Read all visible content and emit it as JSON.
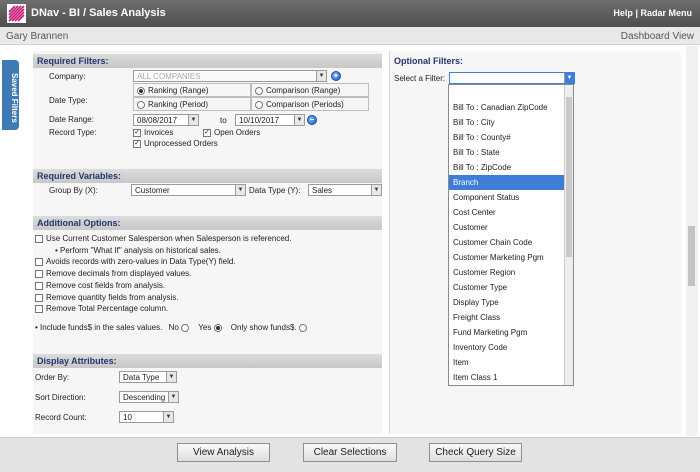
{
  "header": {
    "title": "DNav - BI / Sales Analysis",
    "help": "Help",
    "separator": "|",
    "radar_menu": "Radar Menu"
  },
  "userbar": {
    "user": "Gary Brannen",
    "dashboard_view": "Dashboard View"
  },
  "saved_filters": "Saved Filters",
  "required_filters": {
    "title": "Required Filters:",
    "company_label": "Company:",
    "company_value": "ALL COMPANIES",
    "date_type_label": "Date Type:",
    "date_types": [
      "Ranking (Range)",
      "Comparison (Range)",
      "Ranking (Period)",
      "Comparison (Periods)"
    ],
    "date_range_label": "Date Range:",
    "date_from": "08/08/2017",
    "to_label": "to",
    "date_to": "10/10/2017",
    "record_type_label": "Record Type:",
    "record_types": [
      "Invoices",
      "Open Orders",
      "Unprocessed Orders"
    ]
  },
  "required_variables": {
    "title": "Required Variables:",
    "group_by_label": "Group By (X):",
    "group_by_value": "Customer",
    "data_type_label": "Data Type (Y):",
    "data_type_value": "Sales"
  },
  "additional_options": {
    "title": "Additional Options:",
    "items": [
      "Use Current Customer Salesperson when Salesperson is referenced.",
      "• Perform \"What If\" analysis on historical sales.",
      "Avoids records with zero-values in Data Type(Y) field.",
      "Remove decimals from displayed values.",
      "Remove cost fields from analysis.",
      "Remove quantity fields from analysis.",
      "Remove Total Percentage column."
    ],
    "funds_label": "• Include funds$ in the sales values.",
    "funds_no": "No",
    "funds_yes": "Yes",
    "funds_only": "Only show funds$."
  },
  "display_attributes": {
    "title": "Display Attributes:",
    "order_by_label": "Order By:",
    "order_by_value": "Data Type",
    "sort_direction_label": "Sort Direction:",
    "sort_direction_value": "Descending",
    "record_count_label": "Record Count:",
    "record_count_value": "10"
  },
  "optional_filters": {
    "title": "Optional Filters:",
    "select_label": "Select a Filter:",
    "options": [
      "",
      "Bill To : Canadian ZipCode",
      "Bill To : City",
      "Bill To : County#",
      "Bill To : State",
      "Bill To : ZipCode",
      "Branch",
      "Component Status",
      "Cost Center",
      "Customer",
      "Customer Chain Code",
      "Customer Marketing Pgm",
      "Customer Region",
      "Customer Type",
      "Display Type",
      "Freight Class",
      "Fund Marketing Pgm",
      "Inventory Code",
      "Item",
      "Item Class 1"
    ],
    "selected": "Branch"
  },
  "buttons": {
    "view": "View Analysis",
    "clear": "Clear Selections",
    "check": "Check Query Size"
  },
  "colors": {
    "titlebar": "#5a5a5a",
    "accent": "#3e7ed8",
    "section_text": "#23356b",
    "saved_tab": "#3f7ab5"
  }
}
